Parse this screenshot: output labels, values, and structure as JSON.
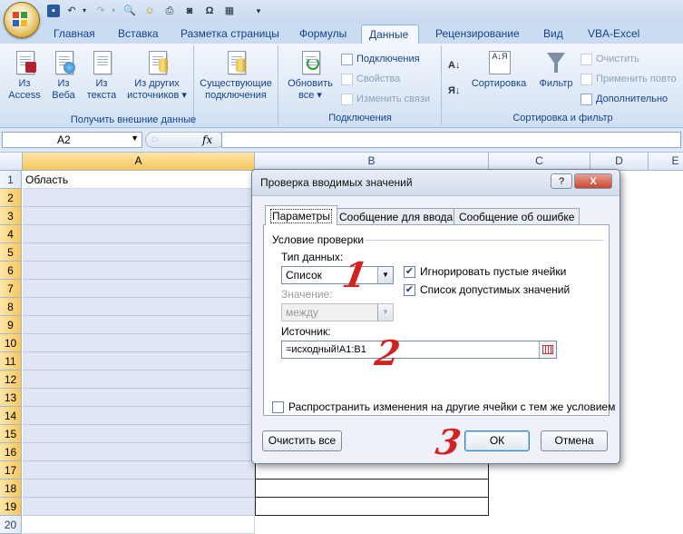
{
  "qat": {
    "icons": [
      "save-icon",
      "undo-icon",
      "redo-icon",
      "print-preview-icon",
      "smiley-icon",
      "printer-icon",
      "camera-icon",
      "omega-icon",
      "table-icon",
      "customize-icon"
    ]
  },
  "tabs": [
    "Главная",
    "Вставка",
    "Разметка страницы",
    "Формулы",
    "Данные",
    "Рецензирование",
    "Вид",
    "VBA-Excel"
  ],
  "active_tab": "Данные",
  "ribbon": {
    "groups": [
      {
        "label": "Получить внешние данные",
        "buttons": [
          {
            "line1": "Из",
            "line2": "Access"
          },
          {
            "line1": "Из",
            "line2": "Веба"
          },
          {
            "line1": "Из",
            "line2": "текста"
          },
          {
            "line1": "Из других",
            "line2": "источников ▾"
          }
        ]
      },
      {
        "label": "",
        "buttons": [
          {
            "line1": "Существующие",
            "line2": "подключения"
          }
        ]
      },
      {
        "label": "Подключения",
        "refresh": {
          "line1": "Обновить",
          "line2": "все ▾"
        },
        "small": [
          "Подключения",
          "Свойства",
          "Изменить связи"
        ]
      },
      {
        "label": "Сортировка и фильтр",
        "sort_az": "А↓Я",
        "sort": "Сортировка",
        "filter": "Фильтр",
        "small": [
          "Очистить",
          "Применить повто",
          "Дополнительно"
        ]
      }
    ]
  },
  "formula_bar": {
    "name_box": "A2",
    "fx": "fx",
    "formula": ""
  },
  "sheet": {
    "columns": [
      "A",
      "B",
      "C",
      "D",
      "E"
    ],
    "rows": [
      "1",
      "2",
      "3",
      "4",
      "5",
      "6",
      "7",
      "8",
      "9",
      "10",
      "11",
      "12",
      "13",
      "14",
      "15",
      "16",
      "17",
      "18",
      "19",
      "20"
    ],
    "A1": "Область"
  },
  "dialog": {
    "title": "Проверка вводимых значений",
    "help": "?",
    "close": "X",
    "tabs": [
      "Параметры",
      "Сообщение для ввода",
      "Сообщение об ошибке"
    ],
    "section": "Условие проверки",
    "data_type_label": "Тип данных:",
    "data_type_value": "Список",
    "ignore_blank": "Игнорировать пустые ячейки",
    "in_cell_dropdown": "Список допустимых значений",
    "value_label": "Значение:",
    "value_value": "между",
    "source_label": "Источник:",
    "source_value": "=исходный!A1:B1",
    "apply_all": "Распространить изменения на другие ячейки с тем же условием",
    "clear_all": "Очистить все",
    "ok": "ОК",
    "cancel": "Отмена"
  },
  "annotations": [
    "1",
    "2",
    "3"
  ],
  "colors": {
    "annotation": "#d42121",
    "selected_header": "#f8c65a",
    "ribbon_text": "#15428b"
  }
}
